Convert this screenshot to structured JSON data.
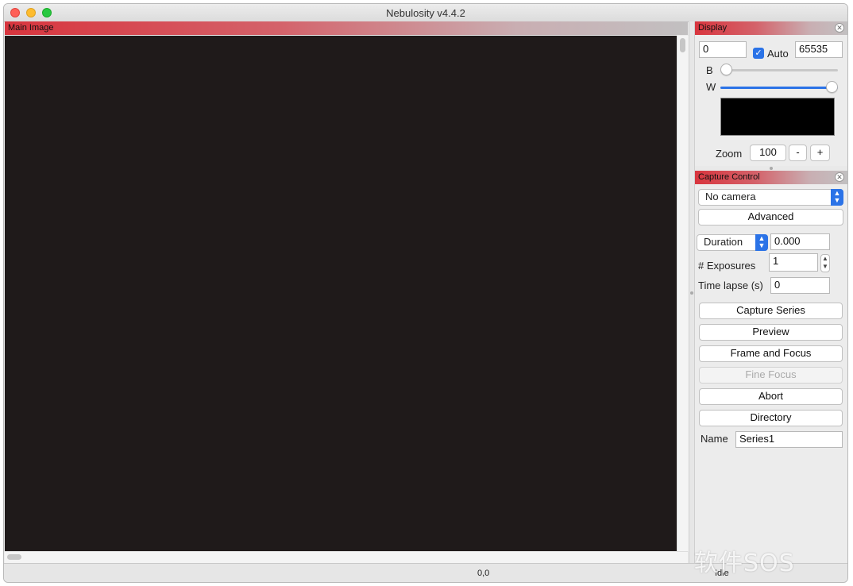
{
  "window": {
    "title": "Nebulosity v4.4.2"
  },
  "main_panel": {
    "title": "Main Image"
  },
  "display_panel": {
    "title": "Display",
    "min_value": "0",
    "auto_label": "Auto",
    "max_value": "65535",
    "b_label": "B",
    "w_label": "W",
    "b_level": 0.0,
    "w_level": 1.0,
    "zoom_label": "Zoom",
    "zoom_value": "100",
    "zoom_minus": "-",
    "zoom_plus": "+"
  },
  "capture_panel": {
    "title": "Capture Control",
    "camera_select": "No camera",
    "advanced_button": "Advanced",
    "duration_select": "Duration",
    "duration_value": "0.000",
    "exposures_label": "# Exposures",
    "exposures_value": "1",
    "timelapse_label": "Time lapse (s)",
    "timelapse_value": "0",
    "capture_series_button": "Capture Series",
    "preview_button": "Preview",
    "frame_focus_button": "Frame and Focus",
    "fine_focus_button": "Fine Focus",
    "abort_button": "Abort",
    "directory_button": "Directory",
    "name_label": "Name",
    "name_value": "Series1"
  },
  "status_bar": {
    "coordinates": "0,0",
    "state": "Idle"
  },
  "watermark": "软件SOS",
  "colors": {
    "panel_header_red": "#d8353e",
    "accent_blue": "#2b73e7",
    "image_bg": "#1f1a1a"
  }
}
